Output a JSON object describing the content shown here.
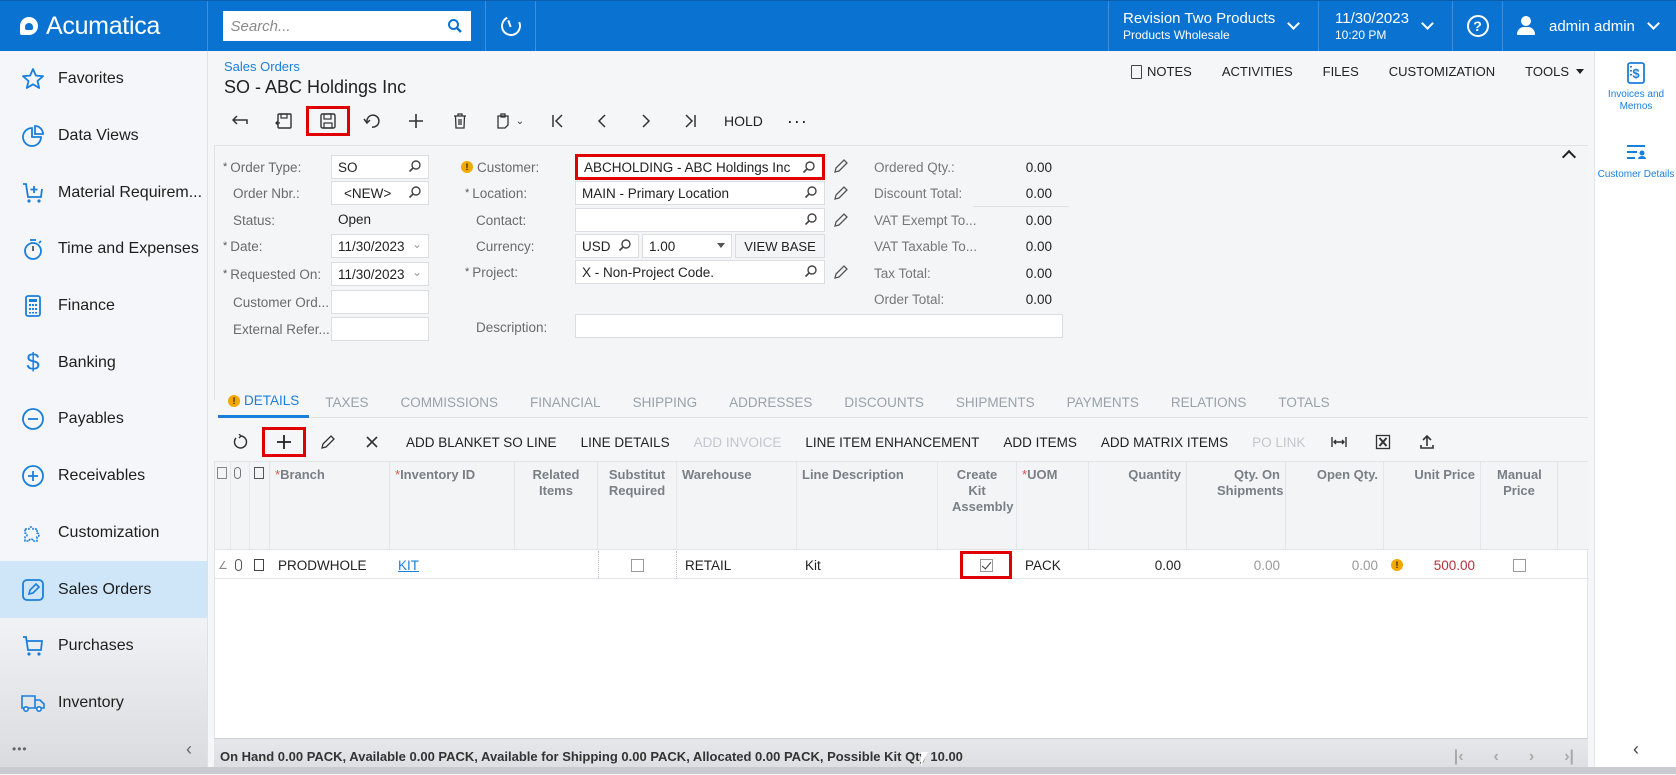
{
  "topbar": {
    "logo": "Acumatica",
    "search_placeholder": "Search...",
    "branch_title": "Revision Two Products",
    "branch_subtitle": "Products Wholesale",
    "date": "11/30/2023",
    "time": "10:20 PM",
    "user": "admin admin"
  },
  "sidebar": {
    "items": [
      {
        "label": "Favorites",
        "icon": "star-icon"
      },
      {
        "label": "Data Views",
        "icon": "pie-chart-icon"
      },
      {
        "label": "Material Requirem...",
        "icon": "cart-plus-icon"
      },
      {
        "label": "Time and Expenses",
        "icon": "stopwatch-icon"
      },
      {
        "label": "Finance",
        "icon": "calculator-icon"
      },
      {
        "label": "Banking",
        "icon": "dollar-icon"
      },
      {
        "label": "Payables",
        "icon": "minus-circle-icon"
      },
      {
        "label": "Receivables",
        "icon": "plus-circle-icon"
      },
      {
        "label": "Customization",
        "icon": "puzzle-icon"
      },
      {
        "label": "Sales Orders",
        "icon": "edit-icon",
        "active": true
      },
      {
        "label": "Purchases",
        "icon": "cart-icon"
      },
      {
        "label": "Inventory",
        "icon": "truck-icon"
      }
    ],
    "more": "•••"
  },
  "header": {
    "breadcrumb": "Sales Orders",
    "title": "SO - ABC Holdings Inc",
    "links": [
      "NOTES",
      "ACTIVITIES",
      "FILES",
      "CUSTOMIZATION",
      "TOOLS"
    ],
    "toolbar_hold": "HOLD",
    "toolbar_more": "···"
  },
  "form": {
    "order_type_label": "Order Type:",
    "order_type": "SO",
    "order_nbr_label": "Order Nbr.:",
    "order_nbr": "<NEW>",
    "status_label": "Status:",
    "status": "Open",
    "date_label": "Date:",
    "date": "11/30/2023",
    "requested_on_label": "Requested On:",
    "requested_on": "11/30/2023",
    "customer_ord_label": "Customer Ord...",
    "customer_ord": "",
    "external_ref_label": "External Refer...",
    "external_ref": "",
    "customer_label": "Customer:",
    "customer": "ABCHOLDING - ABC Holdings Inc",
    "location_label": "Location:",
    "location": "MAIN - Primary Location",
    "contact_label": "Contact:",
    "contact": "",
    "currency_label": "Currency:",
    "currency": "USD",
    "currency_rate": "1.00",
    "view_base": "VIEW BASE",
    "project_label": "Project:",
    "project": "X - Non-Project Code.",
    "description_label": "Description:",
    "description": "",
    "summary": [
      {
        "label": "Ordered Qty.:",
        "value": "0.00"
      },
      {
        "label": "Discount Total:",
        "value": "0.00"
      },
      {
        "label": "VAT Exempt To...",
        "value": "0.00"
      },
      {
        "label": "VAT Taxable To...",
        "value": "0.00"
      },
      {
        "label": "Tax Total:",
        "value": "0.00"
      },
      {
        "label": "Order Total:",
        "value": "0.00"
      }
    ]
  },
  "tabs": [
    "DETAILS",
    "TAXES",
    "COMMISSIONS",
    "FINANCIAL",
    "SHIPPING",
    "ADDRESSES",
    "DISCOUNTS",
    "SHIPMENTS",
    "PAYMENTS",
    "RELATIONS",
    "TOTALS"
  ],
  "grid_toolbar": {
    "add_blanket": "ADD BLANKET SO LINE",
    "line_details": "LINE DETAILS",
    "add_invoice": "ADD INVOICE",
    "line_item_enh": "LINE ITEM ENHANCEMENT",
    "add_items": "ADD ITEMS",
    "add_matrix": "ADD MATRIX ITEMS",
    "po_link": "PO LINK"
  },
  "grid": {
    "headers": {
      "branch": "Branch",
      "inventory_id": "Inventory ID",
      "related_items": "Related Items",
      "substitute": "Substitut Required",
      "warehouse": "Warehouse",
      "line_description": "Line Description",
      "create_kit": "Create Kit Assembly",
      "uom": "UOM",
      "quantity": "Quantity",
      "qty_on_shipments": "Qty. On Shipments",
      "open_qty": "Open Qty.",
      "unit_price": "Unit Price",
      "manual_price": "Manual Price"
    },
    "rows": [
      {
        "branch": "PRODWHOLE",
        "inventory_id": "KIT",
        "substitute_required": false,
        "warehouse": "RETAIL",
        "line_description": "Kit",
        "create_kit_assembly": true,
        "uom": "PACK",
        "quantity": "0.00",
        "qty_on_shipments": "0.00",
        "open_qty": "0.00",
        "unit_price": "500.00",
        "manual_price": false
      }
    ]
  },
  "status_bar": "On Hand 0.00 PACK, Available 0.00 PACK, Available for Shipping 0.00 PACK, Allocated 0.00 PACK, Possible Kit Qty 10.00",
  "right_panel": [
    {
      "label": "Invoices and Memos",
      "icon": "invoice-icon"
    },
    {
      "label": "Customer Details",
      "icon": "customer-details-icon"
    }
  ]
}
